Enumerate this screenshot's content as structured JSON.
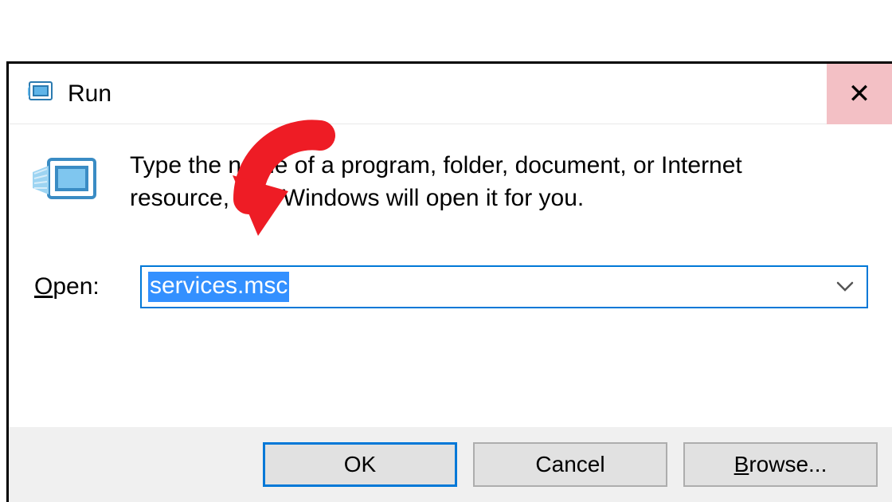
{
  "titlebar": {
    "title": "Run",
    "close_glyph": "✕"
  },
  "body": {
    "description": "Type the name of a program, folder, document, or Internet resource, and Windows will open it for you.",
    "open_label_prefix": "O",
    "open_label_rest": "pen:",
    "input_value": "services.msc"
  },
  "footer": {
    "ok_label": "OK",
    "cancel_label": "Cancel",
    "browse_prefix": "B",
    "browse_rest": "rowse..."
  }
}
